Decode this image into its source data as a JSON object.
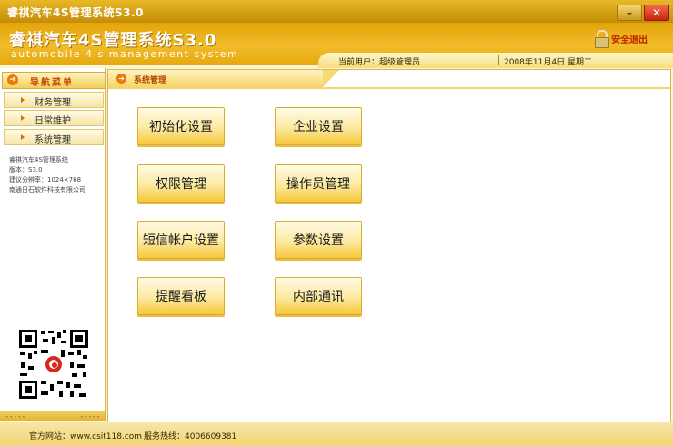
{
  "window": {
    "title": "睿祺汽车4S管理系统S3.0",
    "minimize_label": "–",
    "close_label": "✕"
  },
  "header": {
    "logo": "睿祺汽车4S管理系统S3.0",
    "subtitle": "automobile 4 s management system",
    "logout_label": "安全退出",
    "current_user": "当前用户：超级管理员",
    "date": "2008年11月4日   星期二"
  },
  "sidebar": {
    "title": "导航菜单",
    "items": [
      {
        "label": "财务管理"
      },
      {
        "label": "日常维护"
      },
      {
        "label": "系统管理"
      }
    ],
    "info": [
      "睿祺汽车4S管理系统",
      "版本：S3.0",
      "建议分辨率：1024×768",
      "南通日石软件科技有限公司"
    ]
  },
  "main": {
    "tab_title": "系统管理",
    "buttons": [
      {
        "label": "初始化设置"
      },
      {
        "label": "企业设置"
      },
      {
        "label": "权限管理"
      },
      {
        "label": "操作员管理"
      },
      {
        "label": "短信帐户设置"
      },
      {
        "label": "参数设置"
      },
      {
        "label": "提醒看板"
      },
      {
        "label": "内部通讯"
      }
    ]
  },
  "footer": {
    "website": "官方网站：www.csit118.com",
    "hotline": "服务热线：4006609381"
  },
  "colors": {
    "accent": "#e9ad14",
    "button_gradient_bottom": "#f5c73a",
    "logout_text": "#c01c00"
  }
}
